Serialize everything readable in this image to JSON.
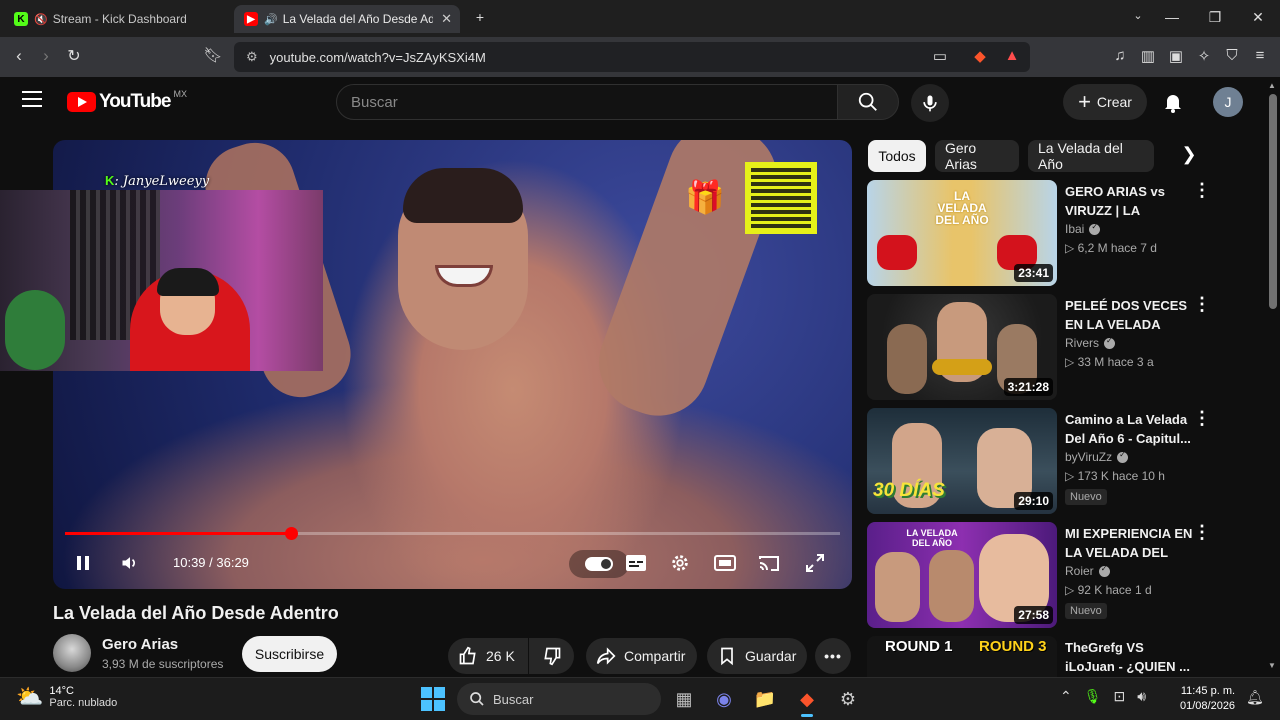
{
  "browser": {
    "tabs": [
      {
        "title": "Stream - Kick Dashboard",
        "icon": "kick-logo-icon",
        "muted": true,
        "active": false
      },
      {
        "title": "La Velada del Año Desde Adentro",
        "icon": "youtube-logo-icon",
        "muted": false,
        "active": true
      }
    ],
    "new_tab_icon": "plus-icon",
    "url": "youtube.com/watch?v=JsZAyKSXi4M"
  },
  "youtube_header": {
    "logo_text": "YouTube",
    "region": "MX",
    "search_placeholder": "Buscar",
    "create_label": "Crear",
    "avatar_initial": "J"
  },
  "player": {
    "overlay_tag_prefix": "K",
    "overlay_tag": ": JanyeLweeyy",
    "current_time": "10:39",
    "duration": "36:29",
    "time_display": "10:39 / 36:29",
    "progress": 0.292
  },
  "video": {
    "title": "La Velada del Año Desde Adentro",
    "channel_name": "Gero Arias",
    "channel_subs": "3,93 M de suscriptores",
    "subscribe_label": "Suscribirse",
    "likes": "26 K",
    "share_label": "Compartir",
    "save_label": "Guardar"
  },
  "chips": [
    "Todos",
    "Gero Arias",
    "La Velada del Año"
  ],
  "recommendations": [
    {
      "title": "GERO ARIAS vs VIRUZZ | LA VELAD...",
      "channel": "Ibai",
      "verified": true,
      "meta": "▷ 6,2 M  hace 7 d",
      "duration": "23:41",
      "badge": ""
    },
    {
      "title": "PELEÉ DOS VECES EN LA VELADA DEL...",
      "channel": "Rivers",
      "verified": true,
      "meta": "▷ 33 M  hace 3 a",
      "duration": "3:21:28",
      "badge": ""
    },
    {
      "title": "Camino a La Velada Del Año 6 - Capitul...",
      "channel": "byViruZz",
      "verified": true,
      "meta": "▷ 173 K  hace 10 h",
      "duration": "29:10",
      "badge": "Nuevo"
    },
    {
      "title": "MI EXPERIENCIA EN LA VELADA DEL AÑ...",
      "channel": "Roier",
      "verified": true,
      "meta": "▷ 92 K  hace 1 d",
      "duration": "27:58",
      "badge": "Nuevo"
    },
    {
      "title": "TheGrefg VS iLoJuan - ¿QUIEN ...",
      "channel": "",
      "verified": false,
      "meta": "",
      "duration": "",
      "badge": ""
    }
  ],
  "thumb_texts": {
    "rec1": "LA VELADA DEL AÑO",
    "rec3": "30 DÍAS",
    "rec4": "LA VELADA DEL AÑO",
    "rec5_left": "ROUND 1",
    "rec5_right": "ROUND 3"
  },
  "taskbar": {
    "temperature": "14°C",
    "condition": "Parc. nublado",
    "search_label": "Buscar",
    "time": "11:45 p. m.",
    "date": "01/08/2026"
  },
  "colors": {
    "youtube_red": "#ff0000",
    "kick_green": "#53fc18",
    "background": "#0f0f0f"
  }
}
